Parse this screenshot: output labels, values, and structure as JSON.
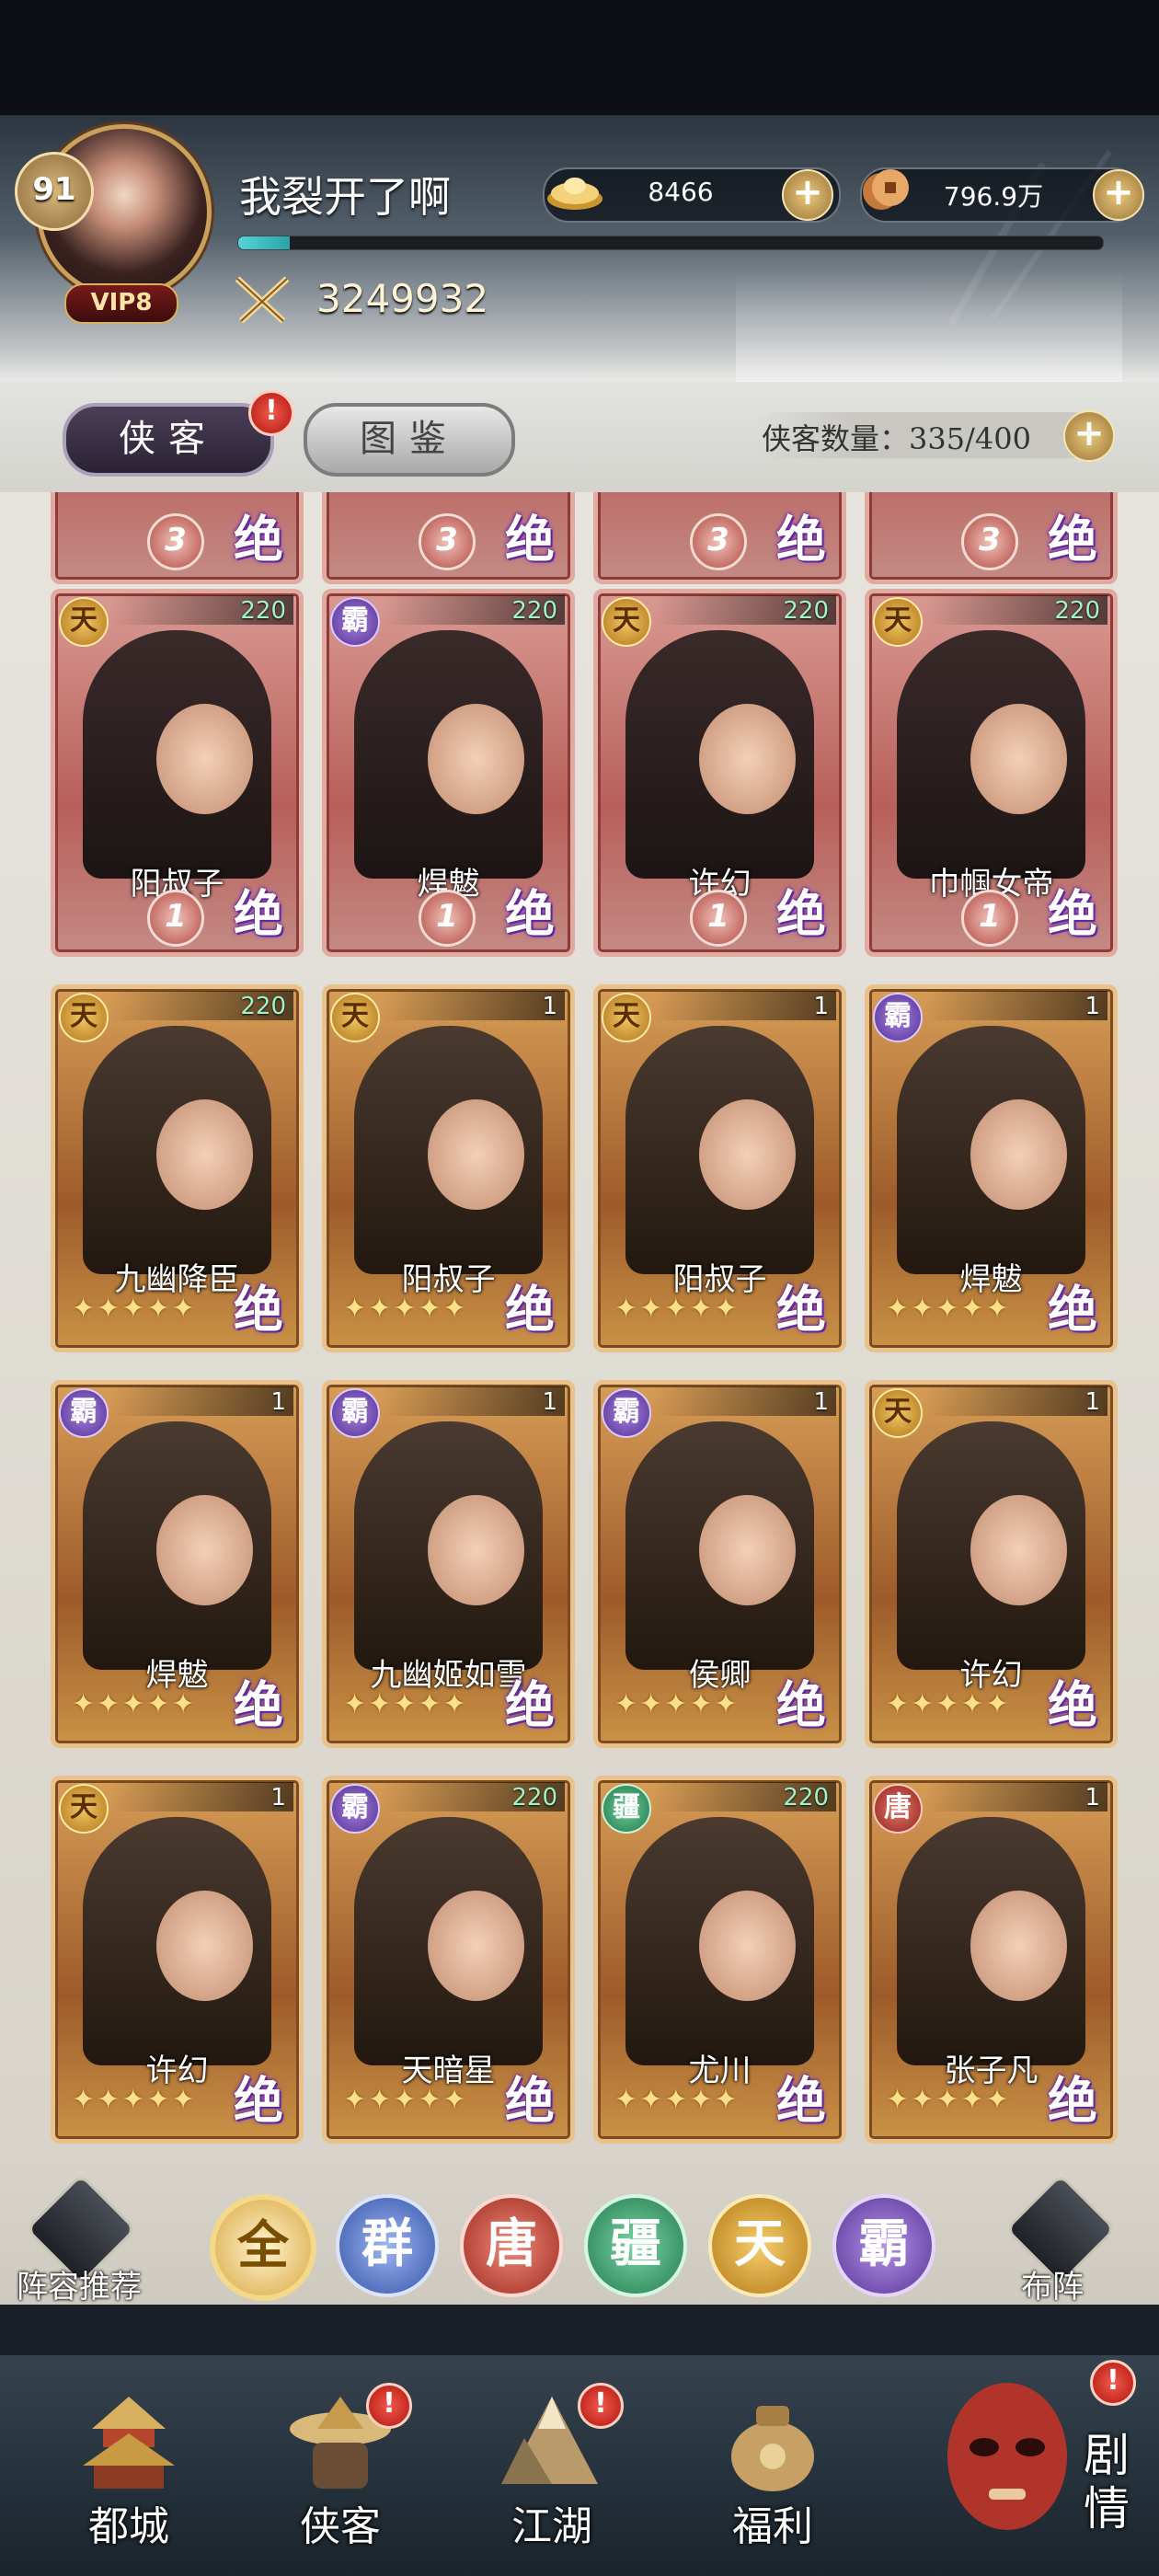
{
  "player": {
    "level": "91",
    "vip": "VIP8",
    "name": "我裂开了啊",
    "power": "3249932",
    "xp_fraction": 0.06
  },
  "resources": {
    "gold_ingot": {
      "value": "8466",
      "icon": "gold-ingot-icon"
    },
    "copper_coin": {
      "value": "796.9万",
      "icon": "copper-coin-icon"
    }
  },
  "tabs": {
    "heroes": "侠客",
    "codex": "图鉴",
    "hero_alert": "!"
  },
  "hero_count": "侠客数量：335/400",
  "partial_row": [
    {
      "rank": "3"
    },
    {
      "rank": "3"
    },
    {
      "rank": "3"
    },
    {
      "rank": "3"
    }
  ],
  "cards": [
    {
      "name": "阳叔子",
      "faction": "天",
      "faction_key": "tian",
      "level": "220",
      "style": "red",
      "rank": "1"
    },
    {
      "name": "焊魃",
      "faction": "霸",
      "faction_key": "ba",
      "level": "220",
      "style": "red",
      "rank": "1"
    },
    {
      "name": "许幻",
      "faction": "天",
      "faction_key": "tian",
      "level": "220",
      "style": "red",
      "rank": "1"
    },
    {
      "name": "巾帼女帝",
      "faction": "天",
      "faction_key": "tian",
      "level": "220",
      "style": "red",
      "rank": "1"
    },
    {
      "name": "九幽降臣",
      "faction": "天",
      "faction_key": "tian",
      "level": "220",
      "style": "gold",
      "stars": "✦✦✦✦✦"
    },
    {
      "name": "阳叔子",
      "faction": "天",
      "faction_key": "tian",
      "level": "1",
      "style": "gold",
      "stars": "✦✦✦✦✦"
    },
    {
      "name": "阳叔子",
      "faction": "天",
      "faction_key": "tian",
      "level": "1",
      "style": "gold",
      "stars": "✦✦✦✦✦"
    },
    {
      "name": "焊魃",
      "faction": "霸",
      "faction_key": "ba",
      "level": "1",
      "style": "gold",
      "stars": "✦✦✦✦✦"
    },
    {
      "name": "焊魃",
      "faction": "霸",
      "faction_key": "ba",
      "level": "1",
      "style": "gold",
      "stars": "✦✦✦✦✦"
    },
    {
      "name": "九幽姬如雪",
      "faction": "霸",
      "faction_key": "ba",
      "level": "1",
      "style": "gold",
      "stars": "✦✦✦✦✦"
    },
    {
      "name": "侯卿",
      "faction": "霸",
      "faction_key": "ba",
      "level": "1",
      "style": "gold",
      "stars": "✦✦✦✦✦"
    },
    {
      "name": "许幻",
      "faction": "天",
      "faction_key": "tian",
      "level": "1",
      "style": "gold",
      "stars": "✦✦✦✦✦"
    },
    {
      "name": "许幻",
      "faction": "天",
      "faction_key": "tian",
      "level": "1",
      "style": "gold",
      "stars": "✦✦✦✦✦"
    },
    {
      "name": "天暗星",
      "faction": "霸",
      "faction_key": "ba",
      "level": "220",
      "style": "gold",
      "stars": "✦✦✦✦✦"
    },
    {
      "name": "尤川",
      "faction": "疆",
      "faction_key": "jiang",
      "level": "220",
      "style": "gold",
      "stars": "✦✦✦✦✦"
    },
    {
      "name": "张子凡",
      "faction": "唐",
      "faction_key": "tang",
      "level": "1",
      "style": "gold",
      "stars": "✦✦✦✦✦"
    }
  ],
  "jue_glyph": "绝",
  "filters": {
    "recommend_label": "阵容推荐",
    "deploy_label": "布阵",
    "items": [
      {
        "label": "全",
        "key": "all"
      },
      {
        "label": "群",
        "key": "qun"
      },
      {
        "label": "唐",
        "key": "tang"
      },
      {
        "label": "疆",
        "key": "jiang"
      },
      {
        "label": "天",
        "key": "tian"
      },
      {
        "label": "霸",
        "key": "ba"
      }
    ]
  },
  "nav": {
    "items": [
      {
        "label": "都城",
        "icon": "city-tower-icon",
        "alert": ""
      },
      {
        "label": "侠客",
        "icon": "hero-hat-icon",
        "alert": "!"
      },
      {
        "label": "江湖",
        "icon": "mountain-icon",
        "alert": "!"
      },
      {
        "label": "福利",
        "icon": "money-bag-icon",
        "alert": ""
      }
    ],
    "story_label": "剧情",
    "story_alert": "!"
  },
  "colors": {
    "accent_gold": "#d9a740",
    "alert_red": "#d1281e",
    "xp_cyan": "#55d4d6"
  }
}
